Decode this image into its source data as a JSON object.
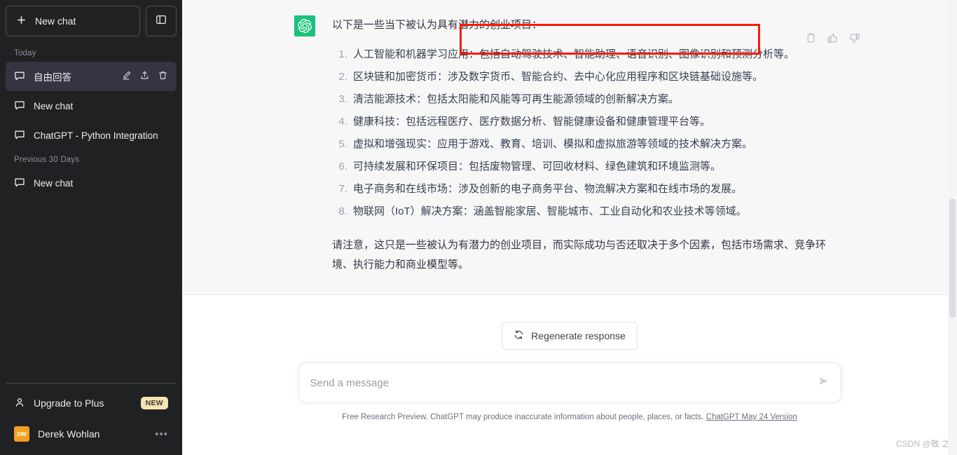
{
  "sidebar": {
    "new_chat_label": "New chat",
    "plus_icon": "plus-icon",
    "toggle_icon": "sidebar-toggle-icon",
    "sections": [
      {
        "label": "Today",
        "chats": [
          {
            "title": "自由回答",
            "active": true
          },
          {
            "title": "New chat",
            "active": false
          },
          {
            "title": "ChatGPT - Python Integration",
            "active": false
          }
        ]
      },
      {
        "label": "Previous 30 Days",
        "chats": [
          {
            "title": "New chat",
            "active": false
          }
        ]
      }
    ],
    "row_actions": [
      "edit-icon",
      "share-icon",
      "delete-icon"
    ],
    "upgrade_label": "Upgrade to Plus",
    "upgrade_badge": "NEW",
    "user_name": "Derek Wohlan",
    "user_initials": "DW",
    "user_menu_dots": "•••"
  },
  "message": {
    "author_icon": "openai-logo-icon",
    "lead": "以下是一些当下被认为具有潜力的创业项目：",
    "items": [
      "人工智能和机器学习应用：包括自动驾驶技术、智能助理、语音识别、图像识别和预测分析等。",
      "区块链和加密货币：涉及数字货币、智能合约、去中心化应用程序和区块链基础设施等。",
      "清洁能源技术：包括太阳能和风能等可再生能源领域的创新解决方案。",
      "健康科技：包括远程医疗、医疗数据分析、智能健康设备和健康管理平台等。",
      "虚拟和增强现实：应用于游戏、教育、培训、模拟和虚拟旅游等领域的技术解决方案。",
      "可持续发展和环保项目：包括废物管理、可回收材料、绿色建筑和环境监测等。",
      "电子商务和在线市场：涉及创新的电子商务平台、物流解决方案和在线市场的发展。",
      "物联网（IoT）解决方案：涵盖智能家居、智能城市、工业自动化和农业技术等领域。"
    ],
    "tail": "请注意，这只是一些被认为有潜力的创业项目，而实际成功与否还取决于多个因素，包括市场需求、竞争环境、执行能力和商业模型等。",
    "actions": [
      "copy-icon",
      "thumbs-up-icon",
      "thumbs-down-icon"
    ]
  },
  "composer": {
    "regenerate_label": "Regenerate response",
    "regenerate_icon": "refresh-icon",
    "input_placeholder": "Send a message",
    "input_value": "",
    "send_icon": "send-icon"
  },
  "footer": {
    "disclaimer": "Free Research Preview. ChatGPT may produce inaccurate information about people, places, or facts.",
    "version_link": "ChatGPT May 24 Version"
  },
  "watermark": "CSDN @敬 之",
  "colors": {
    "sidebar_bg": "#202123",
    "accent_green": "#19c37d",
    "annotation_red": "#fa1a05",
    "badge_yellow": "#f4e4b3",
    "avatar_orange": "#f29f21"
  }
}
